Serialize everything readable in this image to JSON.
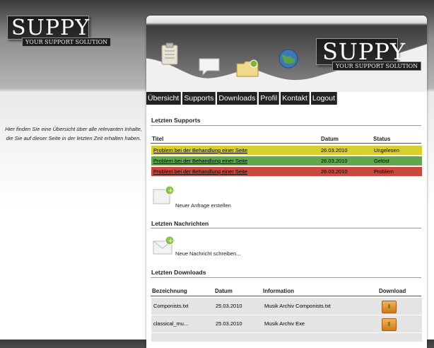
{
  "brand": {
    "name": "SUPPY",
    "tagline": "YOUR SUPPORT SOLUTION"
  },
  "intro_text": "Hier finden Sie eine Übersicht über alle relevanten Inhalte, die Sie auf dieser Seite in der letzten Zeit erhalten haben.",
  "nav": [
    "Übersicht",
    "Supports",
    "Downloads",
    "Profil",
    "Kontakt",
    "Logout"
  ],
  "supports": {
    "title": "Letzten Supports",
    "headers": {
      "title": "Titel",
      "date": "Datum",
      "status": "Status"
    },
    "rows": [
      {
        "title": "Problem bei der Behandlung einer Seite",
        "date": "26.03.2010",
        "status": "Ungelesen",
        "color": "#d8cf2f"
      },
      {
        "title": "Problem bei der Behandlung einer Seite",
        "date": "26.03.2010",
        "status": "Gelöst",
        "color": "#5fa84d"
      },
      {
        "title": "Problem bei der Behandlung einer Seite",
        "date": "26.03.2010",
        "status": "Problem",
        "color": "#c9483b"
      }
    ],
    "action": "Neuer Anfrage erstellen"
  },
  "messages": {
    "title": "Letzten Nachrichten",
    "action": "Neue Nachricht schreiben..."
  },
  "downloads": {
    "title": "Letzten Downloads",
    "headers": {
      "name": "Bezeichnung",
      "date": "Datum",
      "info": "Information",
      "download": "Download"
    },
    "rows": [
      {
        "name": "Componists.txt",
        "date": "25.03.2010",
        "info": "Musik Archiv Componists.txt"
      },
      {
        "name": "classical_mu...",
        "date": "25.03.2010",
        "info": "Musik Archiv Exe"
      }
    ]
  },
  "icons": [
    "clipboard-icon",
    "speech-bubble-icon",
    "folder-icon",
    "globe-icon",
    "download-icon",
    "add-document-icon",
    "add-mail-icon"
  ]
}
